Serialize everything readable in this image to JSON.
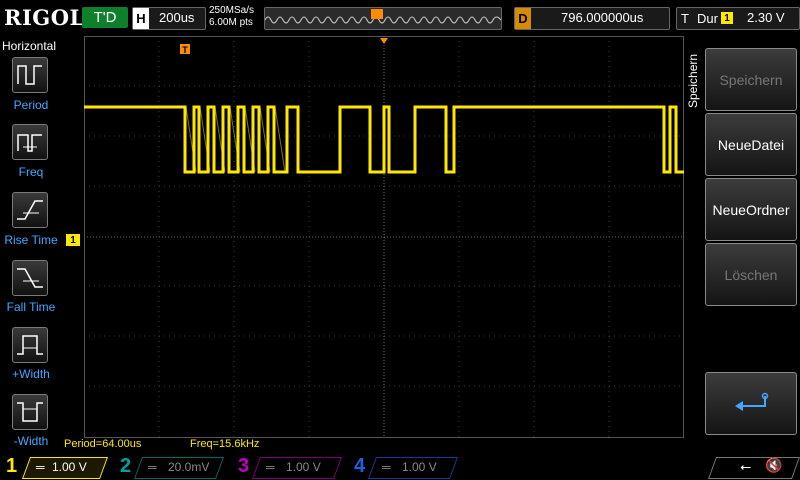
{
  "brand": "RIGOL",
  "trigger_status": "T'D",
  "timebase": {
    "label": "H",
    "value": "200us"
  },
  "acquisition": {
    "sample_rate": "250MSa/s",
    "memory_depth": "6.00M pts"
  },
  "delay": {
    "label": "D",
    "value": "796.000000us"
  },
  "trigger": {
    "type_glyph": "T",
    "mode": "Dur",
    "source": "1",
    "level": "2.30 V"
  },
  "left_menu": {
    "title": "Horizontal",
    "items": [
      {
        "label": "Period"
      },
      {
        "label": "Freq"
      },
      {
        "label": "Rise Time"
      },
      {
        "label": "Fall Time"
      },
      {
        "label": "+Width"
      },
      {
        "label": "-Width"
      }
    ]
  },
  "right_menu": {
    "title": "Speichern",
    "buttons": [
      {
        "label": "Speichern",
        "enabled": false
      },
      {
        "label": "NeueDatei",
        "enabled": true
      },
      {
        "label": "NeueOrdner",
        "enabled": true
      },
      {
        "label": "Löschen",
        "enabled": false
      }
    ]
  },
  "measurements": {
    "period": "Period=64.00us",
    "freq": "Freq=15.6kHz"
  },
  "channels": [
    {
      "num": "1",
      "scale": "1.00 V",
      "color": "#ffe800"
    },
    {
      "num": "2",
      "scale": "20.0mV",
      "color": "#00a0a0"
    },
    {
      "num": "3",
      "scale": "1.00 V",
      "color": "#c000c0"
    },
    {
      "num": "4",
      "scale": "1.00 V",
      "color": "#2060e0"
    }
  ],
  "colors": {
    "ch1": "#ffe800",
    "menu_label": "#40a8ff",
    "trigger_marker": "#ff8c00",
    "trig_status_bg": "#0e7f2a"
  }
}
